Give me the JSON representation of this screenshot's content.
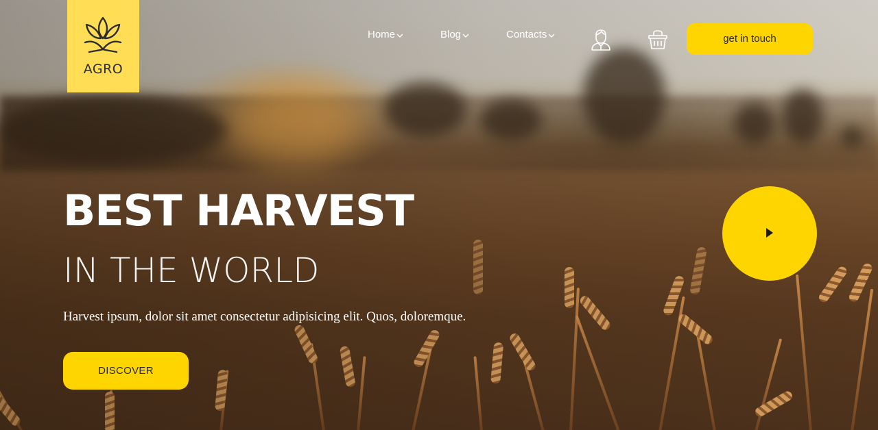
{
  "brand": {
    "name": "AGRO",
    "logo_icon": "wheat-sprout-icon",
    "logo_bg": "#ffdd55"
  },
  "nav": {
    "items": [
      {
        "label": "Home",
        "icon": "chevron-down-icon"
      },
      {
        "label": "Blog",
        "icon": "chevron-down-icon"
      },
      {
        "label": "Contacts",
        "icon": "chevron-down-icon"
      }
    ],
    "user_icon": "user-profile-icon",
    "cart_icon": "basket-icon",
    "cta_label": "get in touch"
  },
  "hero": {
    "headline": "BEST HARVEST",
    "subheadline": "IN THE WORLD",
    "description": "Harvest ipsum, dolor sit amet consectetur adipisicing elit. Quos, doloremque.",
    "button_label": "DISCOVER",
    "play_icon": "play-icon"
  },
  "colors": {
    "accent": "#ffd500",
    "text": "#ffffff",
    "button_text": "#2a2a2a"
  }
}
